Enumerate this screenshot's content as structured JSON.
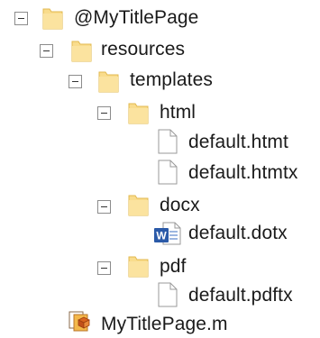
{
  "tree": {
    "root": {
      "label": "@MyTitlePage",
      "state": "expanded"
    },
    "resources": {
      "label": "resources",
      "state": "expanded"
    },
    "templates": {
      "label": "templates",
      "state": "expanded"
    },
    "html": {
      "label": "html",
      "state": "expanded",
      "files": [
        {
          "label": "default.htmt"
        },
        {
          "label": "default.htmtx"
        }
      ]
    },
    "docx": {
      "label": "docx",
      "state": "expanded",
      "files": [
        {
          "label": "default.dotx"
        }
      ]
    },
    "pdf": {
      "label": "pdf",
      "state": "expanded",
      "files": [
        {
          "label": "default.pdftx"
        }
      ]
    },
    "mfile": {
      "label": "MyTitlePage.m"
    }
  },
  "icons": {
    "folder": "folder-icon",
    "file": "file-icon",
    "word": "word-document-icon",
    "matlab": "matlab-class-icon",
    "toggle": "collapse-toggle-icon"
  },
  "colors": {
    "folder_fill": "#f9dc8c",
    "folder_stroke": "#e2b94f",
    "word_blue": "#2b5aa8",
    "toggle_border": "#8c8c8c"
  }
}
